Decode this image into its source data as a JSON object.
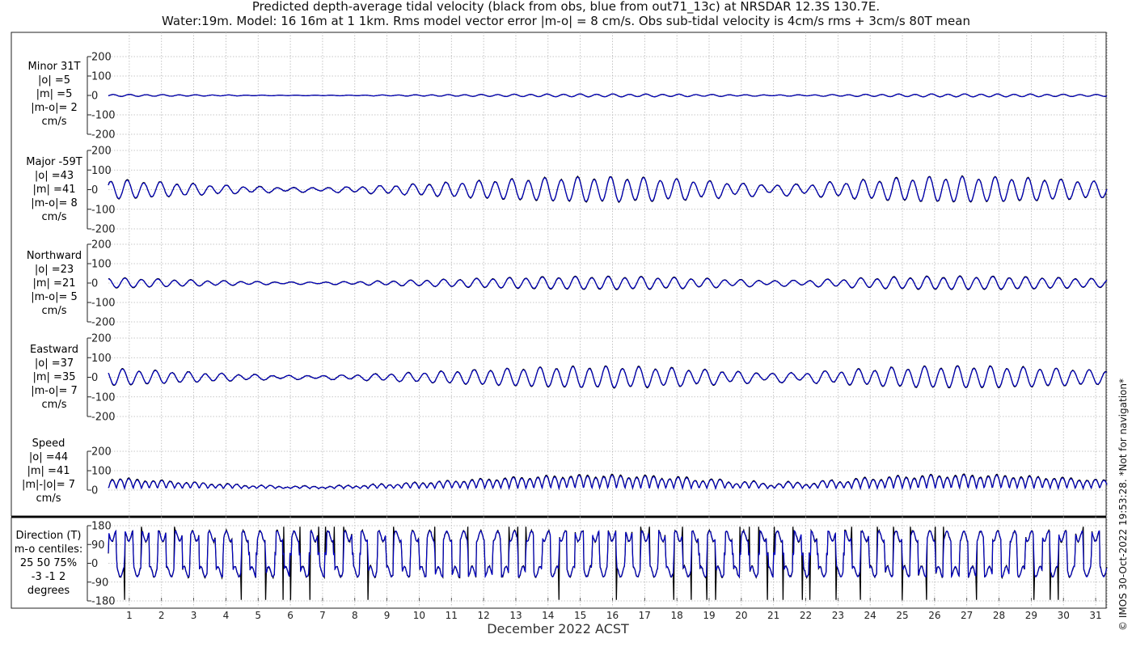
{
  "title": {
    "line1": "Predicted depth-average tidal velocity (black from obs, blue from out71_13c) at NRSDAR 12.3S 130.7E.",
    "line2": "Water:19m. Model: 16 16m at 1 1km. Rms model vector error |m-o| = 8 cm/s. Obs sub-tidal velocity is 4cm/s rms + 3cm/s 80T mean"
  },
  "xlabel": "December 2022 ACST",
  "credit": "© IMOS 30-Oct-2022 19:53:28. *Not for navigation*",
  "colors": {
    "obs": "#000000",
    "model": "#0000cc",
    "grid": "#b5b5b5"
  },
  "chart_data": {
    "type": "line",
    "x_ticks": [
      "1",
      "2",
      "3",
      "4",
      "5",
      "6",
      "7",
      "8",
      "9",
      "10",
      "11",
      "12",
      "13",
      "14",
      "15",
      "16",
      "17",
      "18",
      "19",
      "20",
      "21",
      "22",
      "23",
      "24",
      "25",
      "26",
      "27",
      "28",
      "29",
      "30",
      "31"
    ],
    "xlim": [
      0.35,
      31.35
    ],
    "grid": true,
    "series_names": [
      "obs",
      "model"
    ],
    "panels": [
      {
        "id": "minor",
        "label": [
          "Minor 31T",
          "|o| =5",
          "|m| =5",
          "|m-o|= 2",
          "cm/s"
        ],
        "yticks": [
          "200",
          "100",
          "0",
          "-100",
          "-200"
        ],
        "ylim": [
          -200,
          200
        ],
        "obs_amp": 5,
        "model_amp": 5,
        "kind": "velocity"
      },
      {
        "id": "major",
        "label": [
          "Major -59T",
          "|o| =43",
          "|m| =41",
          "|m-o|= 8",
          "cm/s"
        ],
        "yticks": [
          "200",
          "100",
          "0",
          "-100",
          "-200"
        ],
        "ylim": [
          -200,
          200
        ],
        "obs_amp": 43,
        "model_amp": 41,
        "kind": "velocity"
      },
      {
        "id": "north",
        "label": [
          "Northward",
          "|o| =23",
          "|m| =21",
          "|m-o|= 5",
          "cm/s"
        ],
        "yticks": [
          "200",
          "100",
          "0",
          "-100",
          "-200"
        ],
        "ylim": [
          -200,
          200
        ],
        "obs_amp": 23,
        "model_amp": 21,
        "kind": "velocity"
      },
      {
        "id": "east",
        "label": [
          "Eastward",
          "|o| =37",
          "|m| =35",
          "|m-o|= 7",
          "cm/s"
        ],
        "yticks": [
          "200",
          "100",
          "0",
          "-100",
          "-200"
        ],
        "ylim": [
          -200,
          200
        ],
        "obs_amp": 37,
        "model_amp": 35,
        "kind": "velocity"
      },
      {
        "id": "speed",
        "label": [
          "Speed",
          "|o| =44",
          "|m| =41",
          "|m|-|o|= 7",
          "cm/s"
        ],
        "yticks": [
          "200",
          "100",
          "0"
        ],
        "ylim": [
          0,
          200
        ],
        "obs_amp": 44,
        "model_amp": 41,
        "kind": "speed"
      },
      {
        "id": "direction",
        "label": [
          "Direction (T)",
          "m-o centiles:",
          "25  50  75%",
          "-3 -1  2",
          "degrees"
        ],
        "yticks": [
          "180",
          "90",
          "0",
          "-90",
          "-180"
        ],
        "ylim": [
          -180,
          180
        ],
        "kind": "direction"
      }
    ]
  }
}
